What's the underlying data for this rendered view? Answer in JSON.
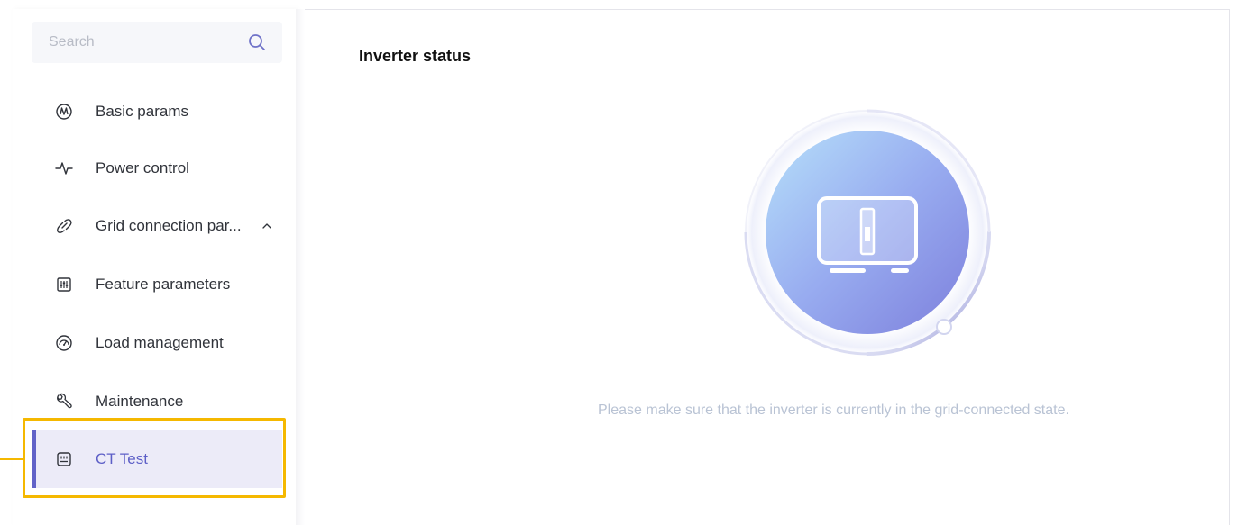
{
  "search": {
    "placeholder": "Search",
    "icon": "search-icon"
  },
  "sidebar": {
    "items": [
      {
        "label": "Basic params",
        "icon": "waveform-circle-icon"
      },
      {
        "label": "Power control",
        "icon": "pulse-icon"
      },
      {
        "label": "Grid connection par...",
        "icon": "link-icon",
        "expand_icon": "chevron-up-icon"
      },
      {
        "label": "Feature parameters",
        "icon": "sliders-icon"
      },
      {
        "label": "Load management",
        "icon": "gauge-icon"
      },
      {
        "label": "Maintenance",
        "icon": "wrench-icon"
      },
      {
        "label": "CT Test",
        "icon": "device-icon",
        "active": true
      }
    ]
  },
  "main": {
    "title": "Inverter status",
    "status_icon": "inverter-icon",
    "hint": "Please make sure that the inverter is currently in the grid-connected state."
  },
  "colors": {
    "accent": "#6263c8",
    "active_bg": "#ecebf8",
    "highlight": "#f5b800",
    "hint_text": "#b9c3d4"
  }
}
